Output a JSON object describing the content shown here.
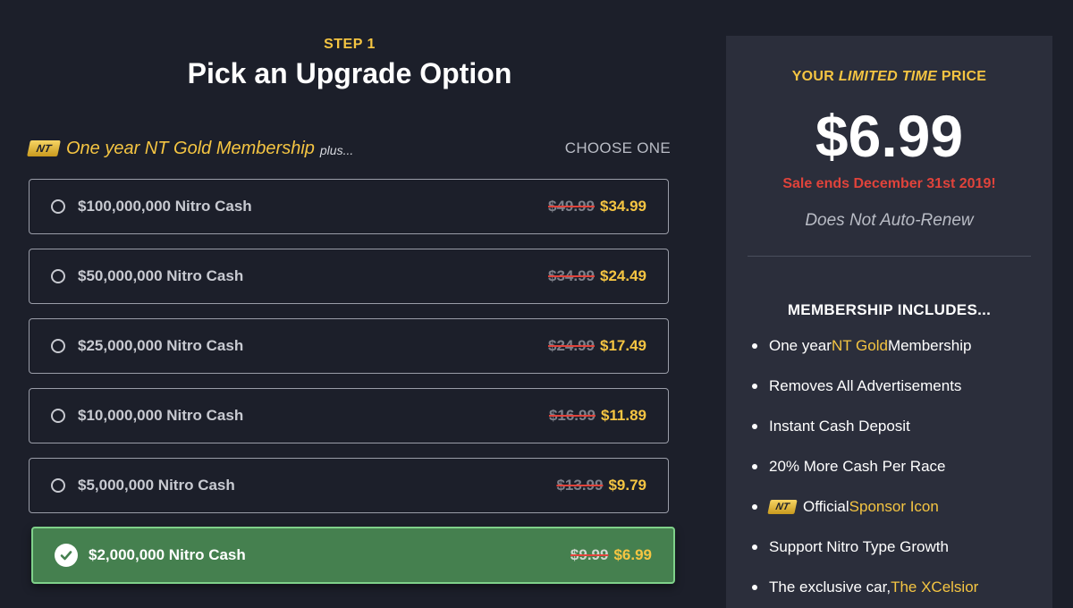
{
  "step": {
    "label": "STEP 1",
    "title": "Pick an Upgrade Option"
  },
  "subhead": {
    "badge": "NT",
    "membership": "One year NT Gold Membership",
    "plus": "plus...",
    "choose": "CHOOSE ONE"
  },
  "options": [
    {
      "label": "$100,000,000 Nitro Cash",
      "old_price": "$49.99",
      "new_price": "$34.99",
      "selected": false
    },
    {
      "label": "$50,000,000 Nitro Cash",
      "old_price": "$34.99",
      "new_price": "$24.49",
      "selected": false
    },
    {
      "label": "$25,000,000 Nitro Cash",
      "old_price": "$24.99",
      "new_price": "$17.49",
      "selected": false
    },
    {
      "label": "$10,000,000 Nitro Cash",
      "old_price": "$16.99",
      "new_price": "$11.89",
      "selected": false
    },
    {
      "label": "$5,000,000 Nitro Cash",
      "old_price": "$13.99",
      "new_price": "$9.79",
      "selected": false
    },
    {
      "label": "$2,000,000 Nitro Cash",
      "old_price": "$9.99",
      "new_price": "$6.99",
      "selected": true
    }
  ],
  "panel": {
    "heading_pre": "YOUR ",
    "heading_em": "LIMITED TIME",
    "heading_post": " PRICE",
    "price": "$6.99",
    "sale": "Sale ends December 31st 2019!",
    "renew": "Does Not Auto-Renew",
    "includes_title": "MEMBERSHIP INCLUDES...",
    "features": [
      {
        "pre": "One year ",
        "gold": "NT Gold",
        "post": " Membership"
      },
      {
        "pre": "Removes All Advertisements",
        "gold": "",
        "post": ""
      },
      {
        "pre": "Instant Cash Deposit",
        "gold": "",
        "post": ""
      },
      {
        "pre": "20% More Cash Per Race",
        "gold": "",
        "post": ""
      },
      {
        "badge": "NT",
        "pre": "Official ",
        "gold": "Sponsor Icon",
        "post": ""
      },
      {
        "pre": "Support Nitro Type Growth",
        "gold": "",
        "post": ""
      },
      {
        "pre": "The exclusive car, ",
        "gold": "The XCelsior",
        "post": ""
      }
    ]
  },
  "colors": {
    "background": "#1c1f2a",
    "panel": "#2b2e3b",
    "gold": "#f5c542",
    "sale_red": "#e0433b",
    "selected_green": "#45804f"
  }
}
